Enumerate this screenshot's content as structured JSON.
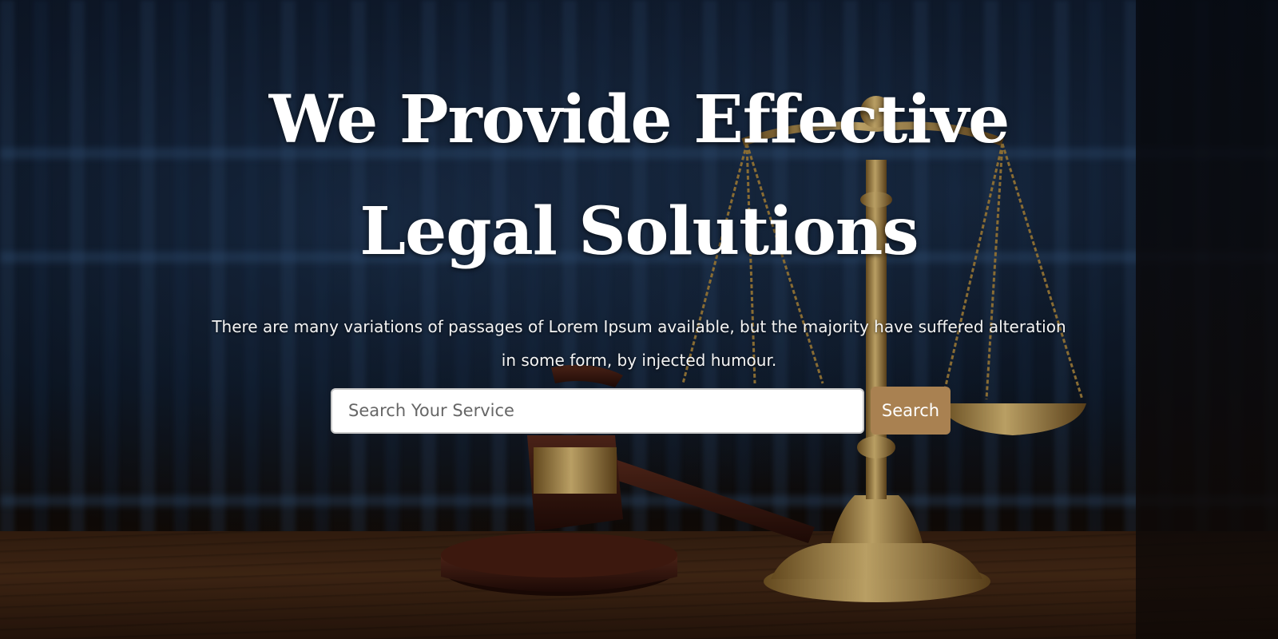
{
  "hero": {
    "title": "We Provide Effective Legal Solutions",
    "subtitle": "There are many variations of passages of Lorem Ipsum available, but the majority have suffered alteration in some form, by injected humour."
  },
  "search": {
    "placeholder": "Search Your Service",
    "value": "",
    "button_label": "Search"
  },
  "colors": {
    "button_bg": "#a98151",
    "background": "#0a0f18",
    "gold": "#b8934a",
    "table_wood": "#4a2c17"
  },
  "icons": {
    "background_image": "scales-of-justice-and-gavel-image"
  }
}
